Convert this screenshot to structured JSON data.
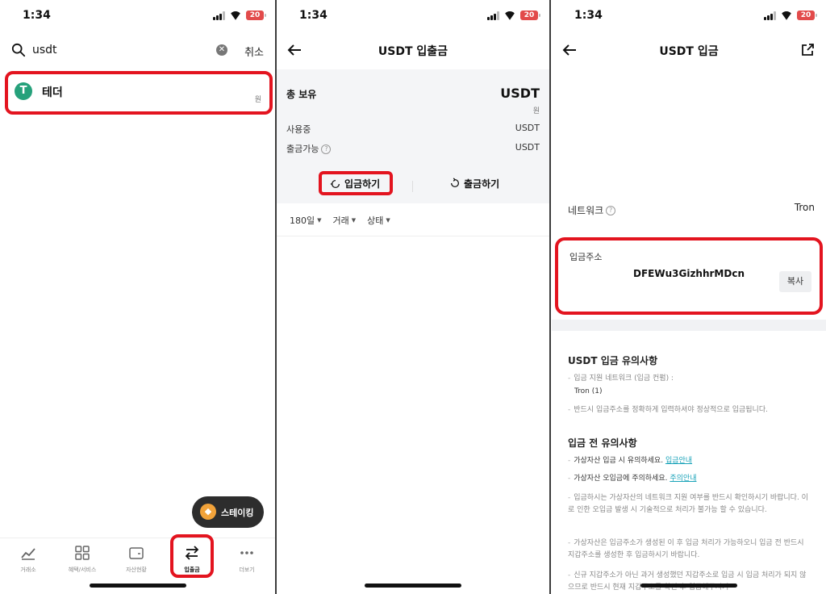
{
  "status_bar": {
    "time": "1:34",
    "battery": "20"
  },
  "panel1": {
    "search": {
      "query": "usdt",
      "cancel_label": "취소"
    },
    "result": {
      "name": "테더",
      "unit": "원",
      "coin_glyph": "T"
    },
    "staking_label": "스테이킹",
    "nav": [
      {
        "label": "거래소",
        "icon": "chart-line-icon"
      },
      {
        "label": "혜택/서비스",
        "icon": "grid-icon"
      },
      {
        "label": "자산현황",
        "icon": "wallet-icon"
      },
      {
        "label": "입출금",
        "icon": "transfer-arrows-icon"
      },
      {
        "label": "더보기",
        "icon": "more-dots-icon"
      }
    ]
  },
  "panel2": {
    "title": "USDT 입출금",
    "total_label": "총 보유",
    "total_value": "USDT",
    "total_unit": "원",
    "in_use_label": "사용중",
    "in_use_value": "USDT",
    "withdrawable_label": "출금가능",
    "withdrawable_value": "USDT",
    "deposit_label": "입금하기",
    "withdraw_label": "출금하기",
    "filters": [
      "180일",
      "거래",
      "상태"
    ]
  },
  "panel3": {
    "title": "USDT 입금",
    "network_label": "네트워크",
    "network_value": "Tron",
    "address_label": "입금주소",
    "address_value": "DFEWu3GizhhrMDcn",
    "copy_label": "복사",
    "notice1_title": "USDT 입금 유의사항",
    "notice1_items": [
      "입금 지원 네트워크 (입금 컨펌) :",
      "Tron (1)",
      "반드시 입금주소를 정확하게 입력하셔야 정상적으로 입금됩니다."
    ],
    "notice2_title": "입금 전 유의사항",
    "notice2_items": [
      "가상자산 입금 시 유의하세요.",
      "입금안내",
      "가상자산 오입금에 주의하세요.",
      "주의안내",
      "입금하시는 가상자산의 네트워크 지원 여부를 반드시 확인하시기 바랍니다. 이로 인한 오입금 발생 시 기술적으로 처리가 불가능 할 수 있습니다.",
      "가상자산은 입금주소가 생성된 이 후 입금 처리가 가능하오니 입금 전 반드시 지갑주소를 생성한 후 입금하시기 바랍니다.",
      "신규 지갑주소가 아닌 과거 생성했던 지갑주소로 입금 시 입금 처리가 되지 않으므로 반드시 현재 지갑주소를 확인 후 입금해주시기"
    ]
  }
}
